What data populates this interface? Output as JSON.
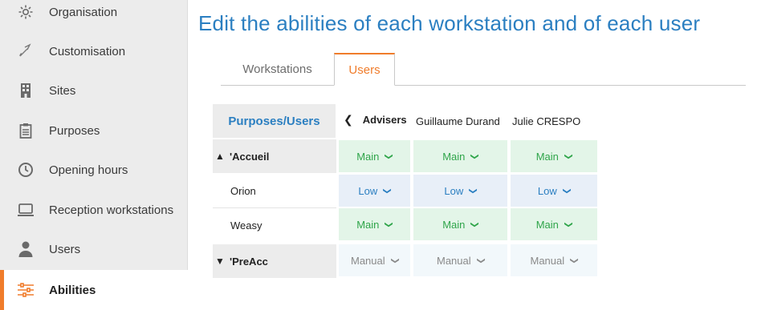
{
  "sidebar": {
    "items": [
      {
        "label": "Organisation",
        "icon": "gear-icon"
      },
      {
        "label": "Customisation",
        "icon": "brush-icon"
      },
      {
        "label": "Sites",
        "icon": "building-icon"
      },
      {
        "label": "Purposes",
        "icon": "clipboard-icon"
      },
      {
        "label": "Opening hours",
        "icon": "clock-icon"
      },
      {
        "label": "Reception workstations",
        "icon": "monitor-icon"
      },
      {
        "label": "Users",
        "icon": "user-icon"
      },
      {
        "label": "Abilities",
        "icon": "sliders-icon",
        "active": true
      }
    ]
  },
  "main": {
    "title": "Edit the abilities of each workstation and of each user",
    "tabs": [
      {
        "label": "Workstations",
        "active": false
      },
      {
        "label": "Users",
        "active": true
      }
    ]
  },
  "grid": {
    "corner_label": "Purposes/Users",
    "group_header": "Advisers",
    "users": [
      "Guillaume Durand",
      "Julie CRESPO"
    ],
    "rows": [
      {
        "label": "'Accueil",
        "group": true,
        "expanded": true,
        "values": [
          "Main",
          "Main",
          "Main"
        ]
      },
      {
        "label": "Orion",
        "group": false,
        "values": [
          "Low",
          "Low",
          "Low"
        ]
      },
      {
        "label": "Weasy",
        "group": false,
        "values": [
          "Main",
          "Main",
          "Main"
        ]
      },
      {
        "label": "'PreAcc",
        "group": true,
        "expanded": false,
        "values": [
          "Manual",
          "Manual",
          "Manual"
        ]
      }
    ]
  },
  "colors": {
    "accent": "#f07c2b",
    "title_blue": "#2b7fc1",
    "main_green": "#2fa54a",
    "main_bg": "#e3f5e8",
    "low_bg": "#e8eff8",
    "manual_bg": "#f2f8fb"
  }
}
